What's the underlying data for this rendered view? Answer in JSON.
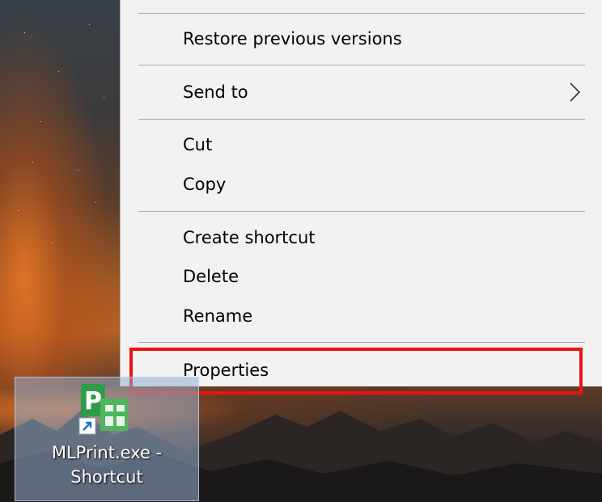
{
  "menu": {
    "items": [
      {
        "label": "Restore previous versions"
      },
      {
        "label": "Send to"
      },
      {
        "label": "Cut"
      },
      {
        "label": "Copy"
      },
      {
        "label": "Create shortcut"
      },
      {
        "label": "Delete"
      },
      {
        "label": "Rename"
      },
      {
        "label": "Properties"
      }
    ],
    "highlighted_item": "Properties",
    "highlight_color": "#ee1111"
  },
  "desktop": {
    "icon": {
      "name": "app-icon",
      "caption_line1": "MLPrint.exe -",
      "caption_line2": "Shortcut"
    }
  }
}
